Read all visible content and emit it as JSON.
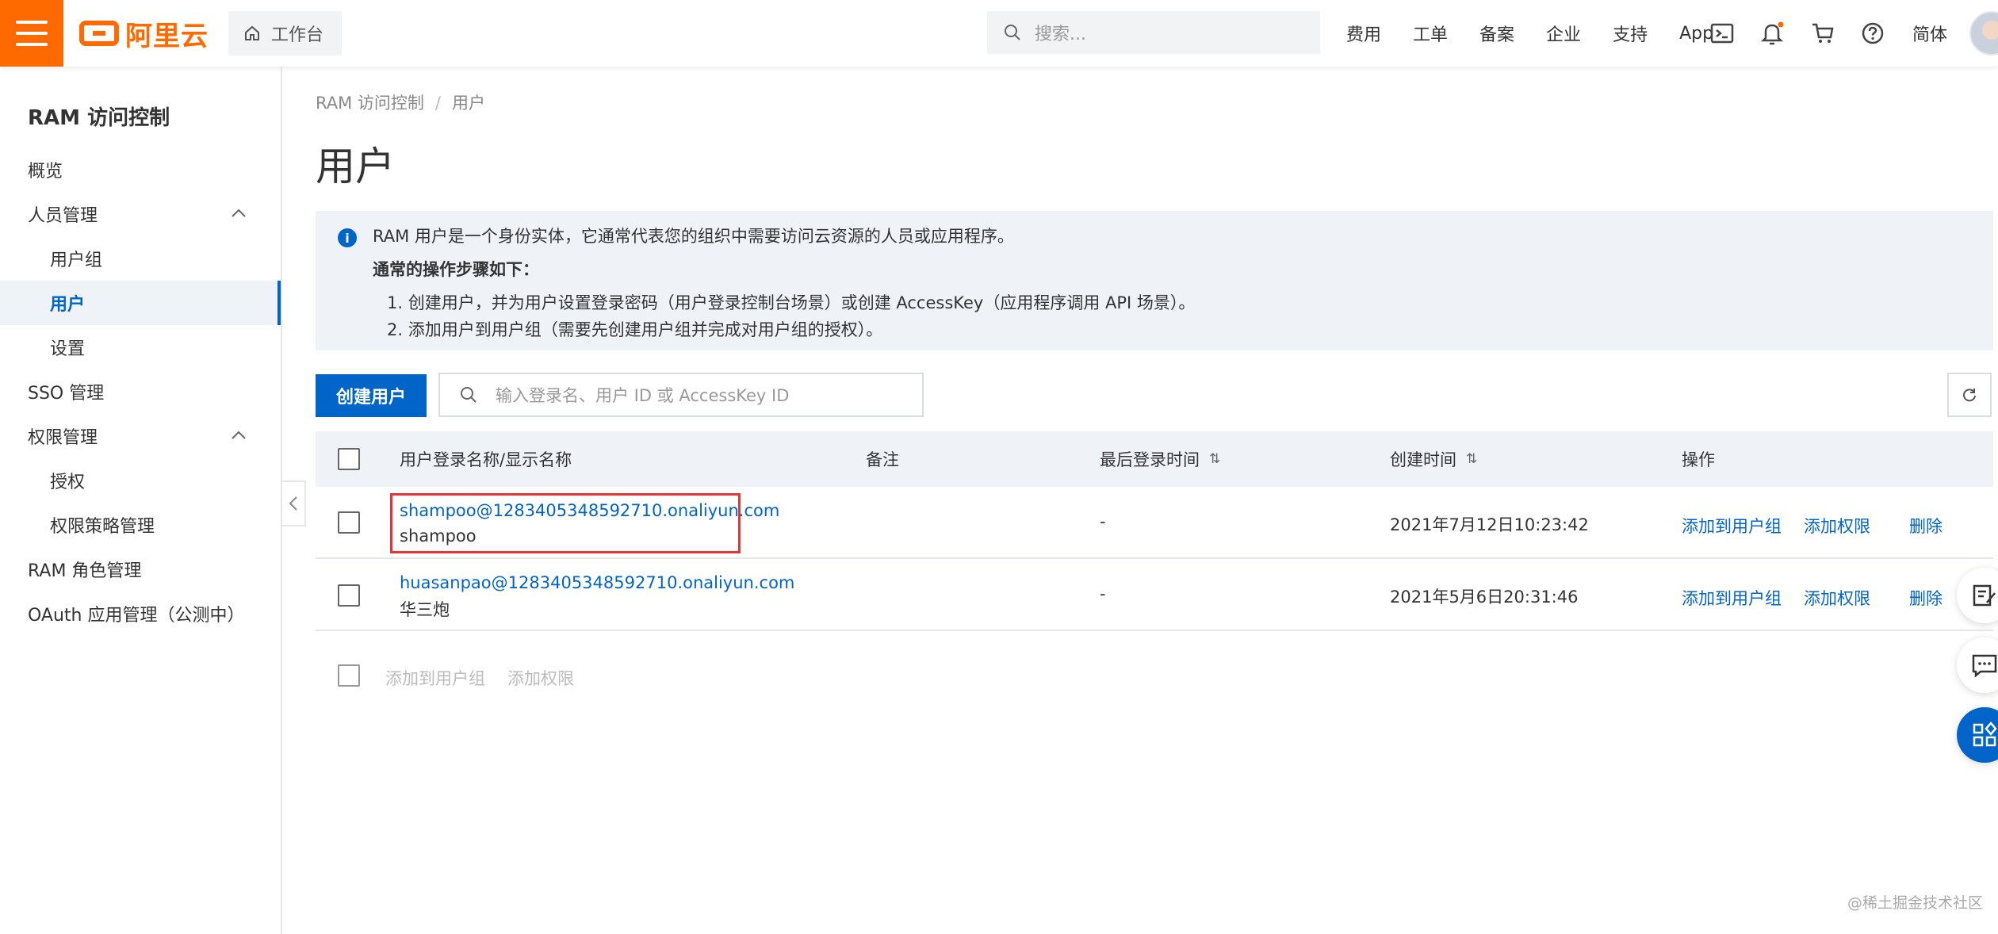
{
  "topbar": {
    "logo_text": "阿里云",
    "workbench_label": "工作台",
    "search_placeholder": "搜索...",
    "nav_links": [
      "费用",
      "工单",
      "备案",
      "企业",
      "支持",
      "App"
    ],
    "lang_label": "简体",
    "icons": [
      "terminal-icon",
      "bell-icon",
      "cart-icon",
      "help-icon"
    ],
    "accent_color": "#ff6a00"
  },
  "sidebar": {
    "title": "RAM 访问控制",
    "items": [
      {
        "label": "概览",
        "level": 1
      },
      {
        "label": "人员管理",
        "level": 1,
        "expanded": true
      },
      {
        "label": "用户组",
        "level": 2
      },
      {
        "label": "用户",
        "level": 2,
        "active": true
      },
      {
        "label": "设置",
        "level": 2
      },
      {
        "label": "SSO 管理",
        "level": 1
      },
      {
        "label": "权限管理",
        "level": 1,
        "expanded": true
      },
      {
        "label": "授权",
        "level": 2
      },
      {
        "label": "权限策略管理",
        "level": 2
      },
      {
        "label": "RAM 角色管理",
        "level": 1
      },
      {
        "label": "OAuth 应用管理（公测中）",
        "level": 1
      }
    ]
  },
  "breadcrumb": {
    "root": "RAM 访问控制",
    "separator": "/",
    "current": "用户"
  },
  "page_title": "用户",
  "info": {
    "intro": "RAM 用户是一个身份实体，它通常代表您的组织中需要访问云资源的人员或应用程序。",
    "steps_title": "通常的操作步骤如下：",
    "step1": "1. 创建用户，并为用户设置登录密码（用户登录控制台场景）或创建 AccessKey（应用程序调用 API 场景）。",
    "step2": "2. 添加用户到用户组（需要先创建用户组并完成对用户组的授权）。"
  },
  "toolbar": {
    "create_label": "创建用户",
    "search_placeholder": "输入登录名、用户 ID 或 AccessKey ID"
  },
  "table": {
    "columns": {
      "name": "用户登录名称/显示名称",
      "note": "备注",
      "last_login": "最后登录时间",
      "created": "创建时间",
      "actions": "操作"
    },
    "rows": [
      {
        "login_name": "shampoo@1283405348592710.onaliyun.com",
        "display_name": "shampoo",
        "note": "",
        "last_login": "-",
        "created": "2021年7月12日10:23:42",
        "actions": [
          "添加到用户组",
          "添加权限",
          "删除"
        ],
        "highlighted": true
      },
      {
        "login_name": "huasanpao@1283405348592710.onaliyun.com",
        "display_name": "华三炮",
        "note": "",
        "last_login": "-",
        "created": "2021年5月6日20:31:46",
        "actions": [
          "添加到用户组",
          "添加权限",
          "删除"
        ],
        "highlighted": false
      }
    ],
    "batch_actions": [
      "添加到用户组",
      "添加权限"
    ]
  },
  "watermark": "@稀土掘金技术社区"
}
